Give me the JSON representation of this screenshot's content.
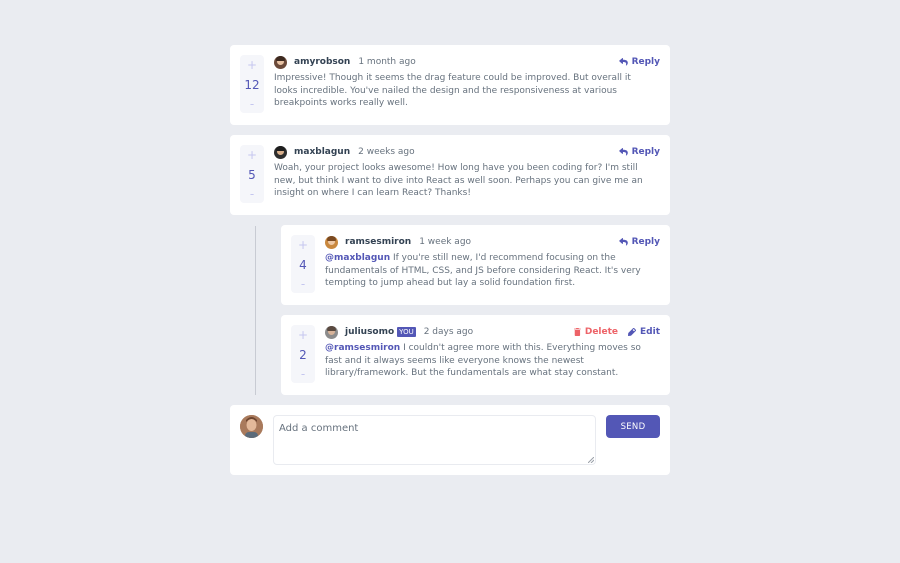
{
  "comments": [
    {
      "score": "12",
      "upvote": "+",
      "downvote": "-",
      "username": "amyrobson",
      "time": "1 month ago",
      "reply_label": "Reply",
      "mention": "",
      "content": "Impressive! Though it seems the drag feature could be improved. But overall it looks incredible. You've nailed the design and the responsiveness at various breakpoints works really well."
    },
    {
      "score": "5",
      "upvote": "+",
      "downvote": "-",
      "username": "maxblagun",
      "time": "2 weeks ago",
      "reply_label": "Reply",
      "mention": "",
      "content": "Woah, your project looks awesome! How long have you been coding for? I'm still new, but think I want to dive into React as well soon. Perhaps you can give me an insight on where I can learn React? Thanks!"
    }
  ],
  "replies": [
    {
      "score": "4",
      "upvote": "+",
      "downvote": "-",
      "username": "ramsesmiron",
      "time": "1 week ago",
      "reply_label": "Reply",
      "mention": "@maxblagun",
      "content": " If you're still new, I'd recommend focusing on the fundamentals of HTML, CSS, and JS before considering React. It's very tempting to jump ahead but lay a solid foundation first."
    },
    {
      "score": "2",
      "upvote": "+",
      "downvote": "-",
      "username": "juliusomo",
      "you_badge": "YOU",
      "time": "2 days ago",
      "delete_label": "Delete",
      "edit_label": "Edit",
      "mention": "@ramsesmiron",
      "content": " I couldn't agree more with this. Everything moves so fast and it always seems like everyone knows the newest library/framework. But the fundamentals are what stay constant."
    }
  ],
  "composer": {
    "placeholder": "Add a comment",
    "send_label": "SEND"
  },
  "icons": {
    "reply": "reply-icon",
    "delete": "trash-icon",
    "edit": "pencil-icon"
  },
  "colors": {
    "background": "#eaecf1",
    "card": "#ffffff",
    "accent": "#5357b6",
    "danger": "#ed6368",
    "username": "#334253",
    "text": "#67727e",
    "vote_bg": "#f5f6fa",
    "vote_btn": "#c5c6ef"
  }
}
